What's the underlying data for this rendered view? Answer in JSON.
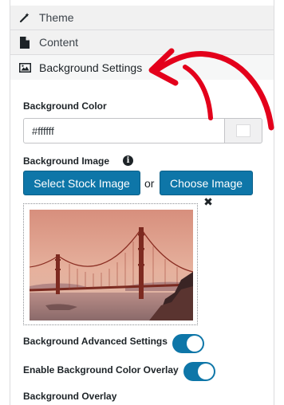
{
  "accordion": {
    "items": [
      {
        "label": "Theme",
        "icon": "magic-wand-icon"
      },
      {
        "label": "Content",
        "icon": "document-icon"
      },
      {
        "label": "Background Settings",
        "icon": "image-icon"
      }
    ]
  },
  "background": {
    "color_label": "Background Color",
    "color_value": "#ffffff",
    "image_label": "Background Image",
    "select_stock_label": "Select Stock Image",
    "or_text": "or",
    "choose_image_label": "Choose Image",
    "remove_glyph": "✖",
    "info_glyph": "i",
    "advanced_label": "Background Advanced Settings",
    "advanced_enabled": true,
    "overlay_color_label": "Enable Background Color Overlay",
    "overlay_color_enabled": true,
    "overlay_label": "Background Overlay"
  },
  "colors": {
    "accent": "#0e76a8",
    "annotation_arrow": "#e3001b"
  }
}
